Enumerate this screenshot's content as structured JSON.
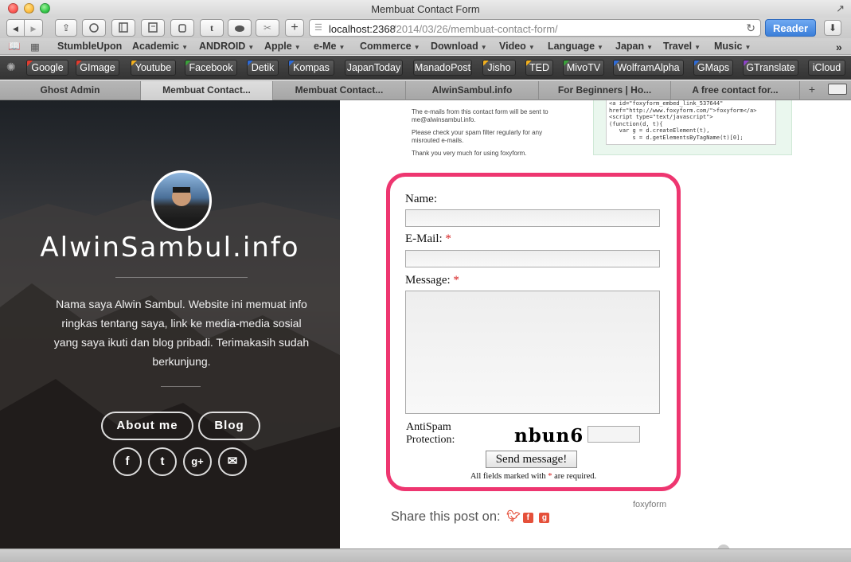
{
  "window": {
    "title": "Membuat Contact Form",
    "fullscreen_icon": "↗"
  },
  "toolbar": {
    "back_icon": "◀",
    "forward_icon": "▶",
    "share_icon": "⇪",
    "new_tab_icon": "+",
    "url_host": "localhost:2368",
    "url_path": "/2014/03/26/membuat-contact-form/",
    "reload_icon": "↻",
    "reader_label": "Reader",
    "download_icon": "⬇"
  },
  "bookmarks": [
    {
      "label": "StumbleUpon",
      "menu": false
    },
    {
      "label": "Academic",
      "menu": true
    },
    {
      "label": "ANDROID",
      "menu": true
    },
    {
      "label": "Apple",
      "menu": true
    },
    {
      "label": "e-Me",
      "menu": true
    },
    {
      "label": "Commerce",
      "menu": true
    },
    {
      "label": "Download",
      "menu": true
    },
    {
      "label": "Video",
      "menu": true
    },
    {
      "label": "Language",
      "menu": true
    },
    {
      "label": "Japan",
      "menu": true
    },
    {
      "label": "Travel",
      "menu": true
    },
    {
      "label": "Music",
      "menu": true
    }
  ],
  "bookmarks_overflow": "»",
  "favorites": [
    {
      "label": "Google",
      "flag": "#e23b2e"
    },
    {
      "label": "GImage",
      "flag": "#e23b2e"
    },
    {
      "label": "Youtube",
      "flag": "#f2b01e"
    },
    {
      "label": "Facebook",
      "flag": "#3aa03a"
    },
    {
      "label": "Detik",
      "flag": "#2e6bd8"
    },
    {
      "label": "Kompas",
      "flag": "#2e6bd8"
    },
    {
      "label": "JapanToday",
      "flag": ""
    },
    {
      "label": "ManadoPost",
      "flag": ""
    },
    {
      "label": "Jisho",
      "flag": "#f2b01e"
    },
    {
      "label": "TED",
      "flag": "#f2b01e"
    },
    {
      "label": "MivoTV",
      "flag": "#3aa03a"
    },
    {
      "label": "WolframAlpha",
      "flag": "#2e6bd8"
    },
    {
      "label": "GMaps",
      "flag": "#2e6bd8"
    },
    {
      "label": "GTranslate",
      "flag": "#8e44c9"
    },
    {
      "label": "iCloud",
      "flag": ""
    }
  ],
  "tabs": [
    {
      "label": "Ghost Admin",
      "active": false
    },
    {
      "label": "Membuat Contact...",
      "active": true
    },
    {
      "label": "Membuat Contact...",
      "active": false
    },
    {
      "label": "AlwinSambul.info",
      "active": false
    },
    {
      "label": "For Beginners | Ho...",
      "active": false
    },
    {
      "label": "A free contact for...",
      "active": false
    }
  ],
  "blog": {
    "title": "AlwinSambul.info",
    "description": "Nama saya Alwin Sambul. Website ini memuat info ringkas tentang saya, link ke media-media sosial yang saya ikuti dan blog pribadi. Terimakasih sudah berkunjung.",
    "about_label": "About me",
    "blog_label": "Blog",
    "social": {
      "facebook": "f",
      "twitter": "t",
      "googleplus": "g+",
      "email": "✉"
    }
  },
  "embed_info": {
    "lines": [
      "The e-mails from this contact form will be sent to me@alwinsambul.info.",
      "Please check your spam filter regularly for any misrouted e-mails.",
      "Thank you very much for using foxyform."
    ],
    "code": "<a id=\"foxyform_embed_link_537644\"\nhref=\"http://www.foxyform.com/\">foxyform</a>\n<script type=\"text/javascript\">\n(function(d, t){\n   var g = d.createElement(t),\n       s = d.getElementsByTagName(t)[0];"
  },
  "form": {
    "name_label": "Name:",
    "email_label": "E-Mail:",
    "message_label": "Message:",
    "required_mark": "*",
    "antispam_line1": "AntiSpam",
    "antispam_line2": "Protection:",
    "captcha_text": "nbun6",
    "send_label": "Send message!",
    "required_note_before": "All fields marked with ",
    "required_note_after": " are required.",
    "name_value": "",
    "email_value": "",
    "message_value": "",
    "captcha_value": ""
  },
  "footer": {
    "foxyform_link": "foxyform",
    "share_label": "Share this post on:"
  },
  "colors": {
    "form_border": "#ee3670",
    "reader_blue": "#3b7fd9",
    "share_twitter": "#e5503a",
    "share_facebook": "#e5503a",
    "share_gplus": "#e5503a"
  }
}
